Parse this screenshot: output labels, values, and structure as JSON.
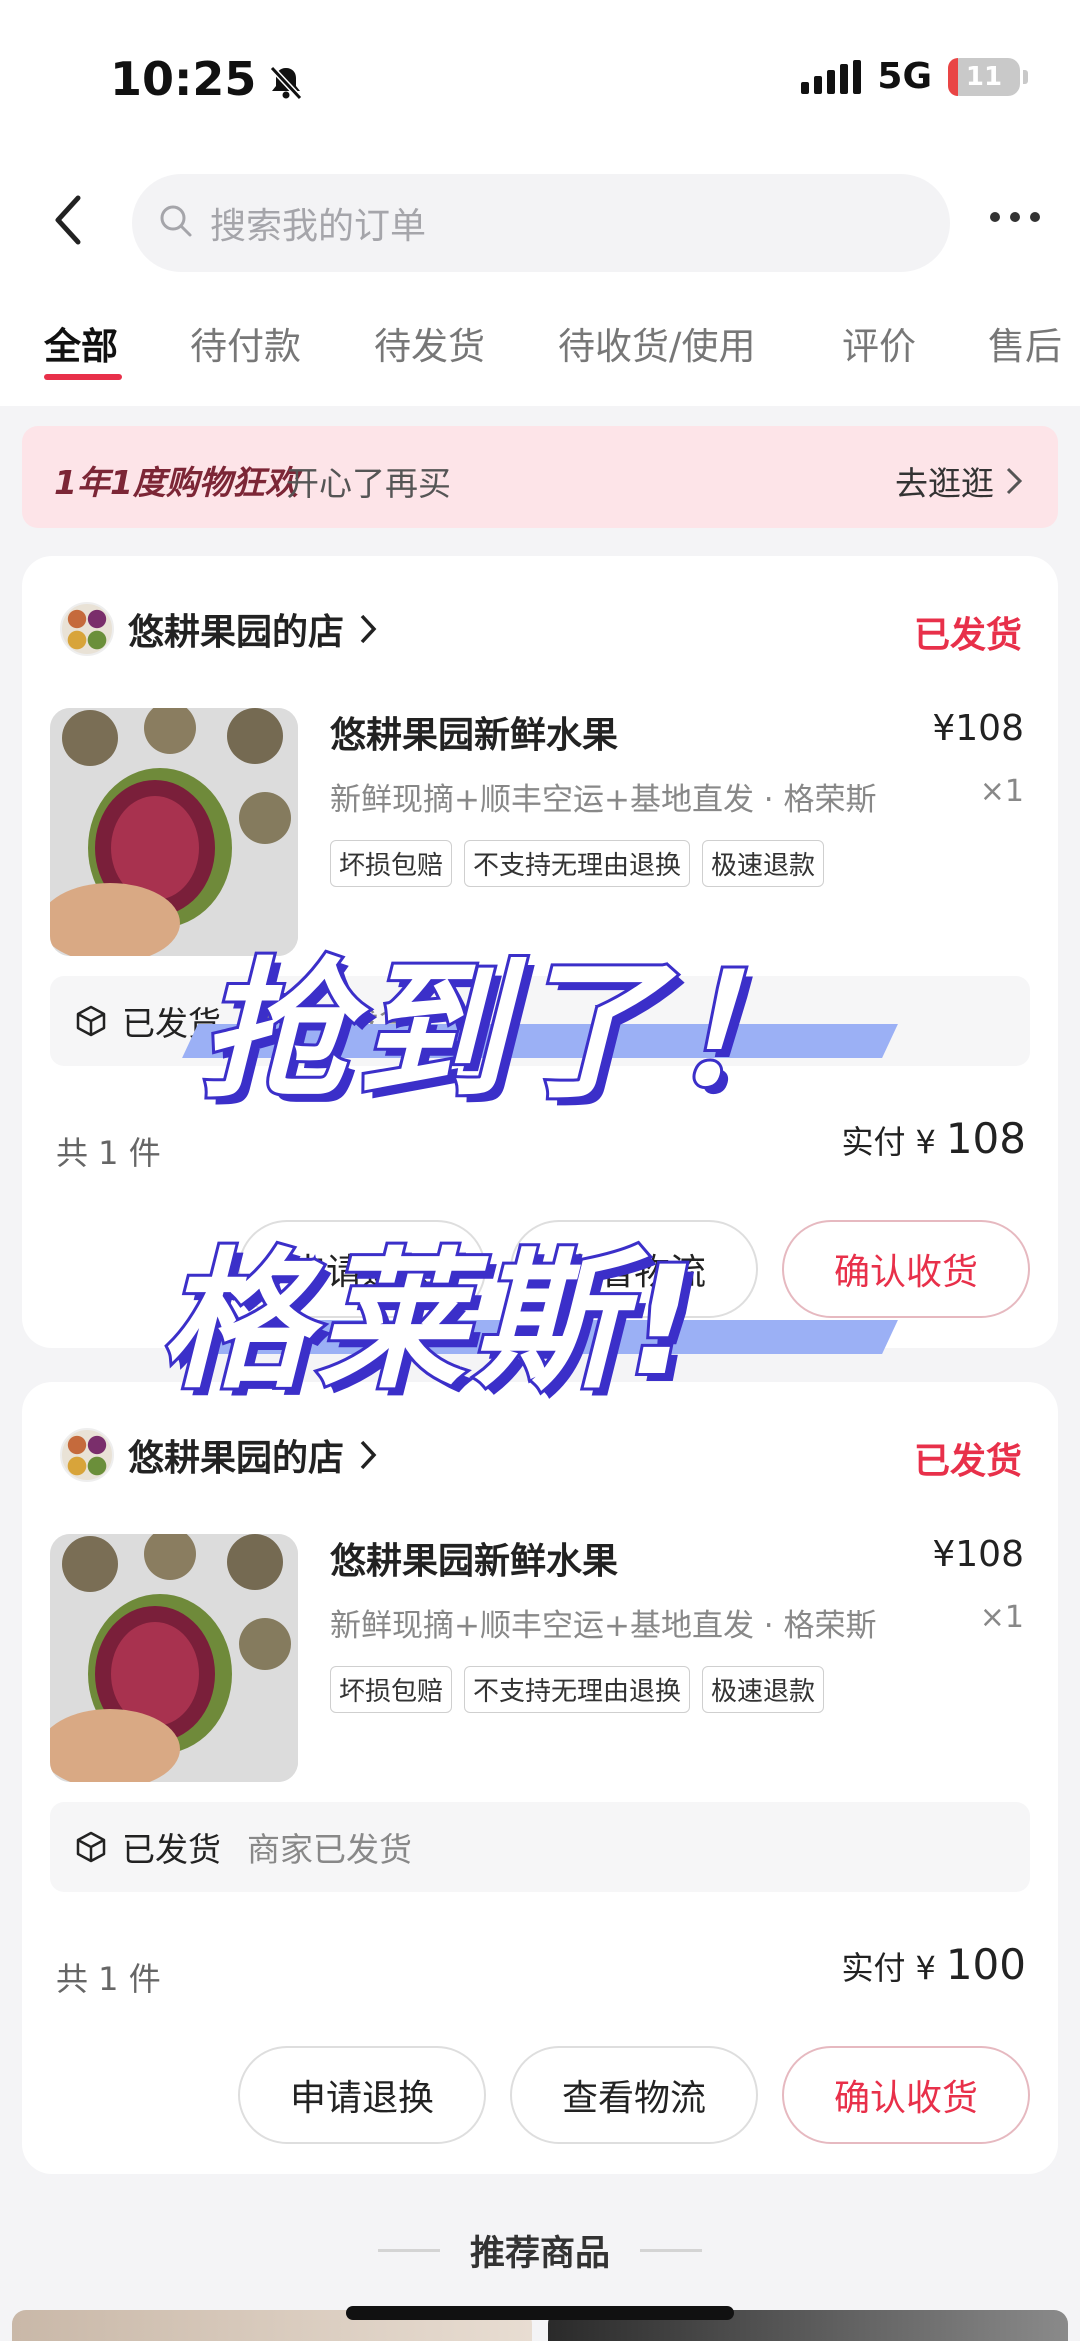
{
  "status_bar": {
    "time": "10:25",
    "network": "5G",
    "battery": "11"
  },
  "search": {
    "placeholder": "搜索我的订单"
  },
  "tabs": [
    {
      "label": "全部"
    },
    {
      "label": "待付款"
    },
    {
      "label": "待发货"
    },
    {
      "label": "待收货/使用"
    },
    {
      "label": "评价"
    },
    {
      "label": "售后"
    }
  ],
  "banner": {
    "title": "1年1度购物狂欢",
    "subtitle": "开心了再买",
    "link": "去逛逛"
  },
  "orders": [
    {
      "shop": "悠耕果园的店",
      "status": "已发货",
      "product": "悠耕果园新鲜水果",
      "price": "¥108",
      "desc": "新鲜现摘+顺丰空运+基地直发 · 格荣斯",
      "qty": "×1",
      "tags": [
        "坏损包赔",
        "不支持无理由退换",
        "极速退款"
      ],
      "ship_label": "已发货",
      "ship_desc": "商家已发货",
      "count": "共 1 件",
      "pay_label": "实付",
      "pay_yen": "¥",
      "pay_amount": "108",
      "buttons": [
        "申请退换",
        "查看物流",
        "确认收货"
      ]
    },
    {
      "shop": "悠耕果园的店",
      "status": "已发货",
      "product": "悠耕果园新鲜水果",
      "price": "¥108",
      "desc": "新鲜现摘+顺丰空运+基地直发 · 格荣斯",
      "qty": "×1",
      "tags": [
        "坏损包赔",
        "不支持无理由退换",
        "极速退款"
      ],
      "ship_label": "已发货",
      "ship_desc": "商家已发货",
      "count": "共 1 件",
      "pay_label": "实付",
      "pay_yen": "¥",
      "pay_amount": "100",
      "buttons": [
        "申请退换",
        "查看物流",
        "确认收货"
      ]
    }
  ],
  "recommend": {
    "title": "推荐商品"
  },
  "overlay": {
    "line1": "抢到了！",
    "line2": "格莱斯!"
  },
  "colors": {
    "accent": "#e8304a",
    "banner_bg": "#fde4e8",
    "overlay_stroke": "#3b2fc9",
    "overlay_stripe": "#9bb0f5"
  }
}
